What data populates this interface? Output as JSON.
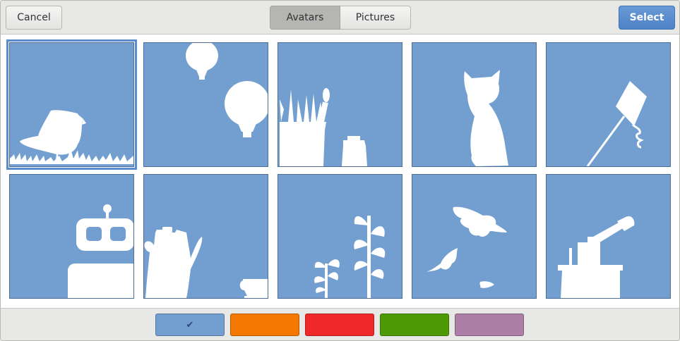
{
  "header": {
    "cancel_label": "Cancel",
    "select_label": "Select",
    "tabs": [
      {
        "label": "Avatars",
        "active": true
      },
      {
        "label": "Pictures",
        "active": false
      }
    ]
  },
  "avatars": [
    {
      "name": "bird",
      "selected": true
    },
    {
      "name": "hot-air-balloons",
      "selected": false
    },
    {
      "name": "paint-brushes",
      "selected": false
    },
    {
      "name": "cat",
      "selected": false
    },
    {
      "name": "kite",
      "selected": false
    },
    {
      "name": "robot",
      "selected": false
    },
    {
      "name": "coffee-pot",
      "selected": false
    },
    {
      "name": "plant-sprouts",
      "selected": false
    },
    {
      "name": "falling-leaves",
      "selected": false
    },
    {
      "name": "telescope",
      "selected": false
    }
  ],
  "colors": {
    "tile_background": "#729fcf",
    "swatches": [
      "#729fcf",
      "#f57900",
      "#ef2929",
      "#4e9a06",
      "#ad7fa8"
    ],
    "selected_swatch": 0
  }
}
